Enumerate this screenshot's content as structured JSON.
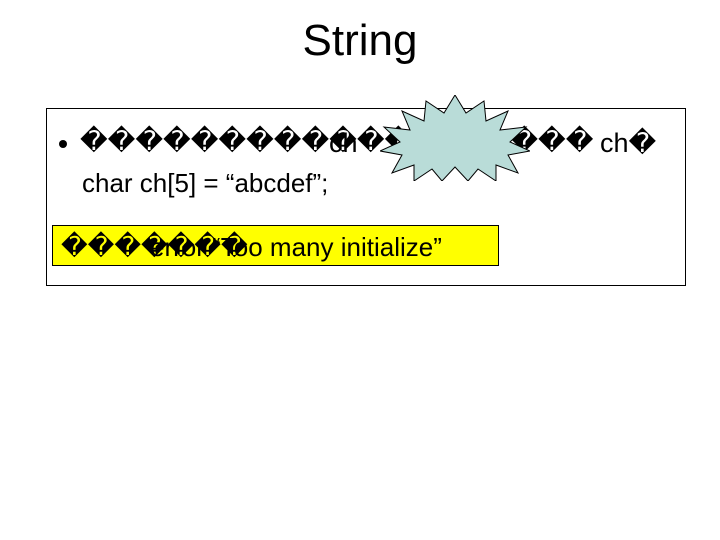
{
  "title": "String",
  "bullet": {
    "squares_left": "������������",
    "squares_mid_label": "ch",
    "squares_right_prefix": "�����",
    "squares_right_label": "ch�",
    "code": "char ch[5] = “abcdef”;"
  },
  "error_box": {
    "prefix_squares": "�������",
    "overlay_text": "error  “Too many initialize”"
  },
  "starburst": {
    "fill": "#b9dcd8",
    "stroke": "#000000"
  }
}
